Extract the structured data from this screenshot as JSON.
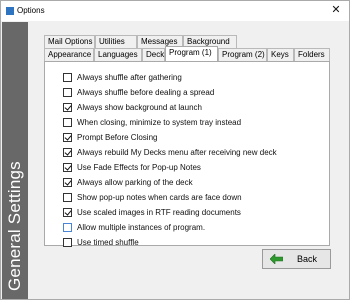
{
  "window": {
    "title": "Options",
    "close_glyph": "✕"
  },
  "side_banner": {
    "text": "General Settings"
  },
  "tabs_row1": [
    {
      "label": "Mail Options"
    },
    {
      "label": "Utilities"
    },
    {
      "label": "Messages"
    },
    {
      "label": "Background"
    }
  ],
  "tabs_row2": [
    {
      "label": "Appearance"
    },
    {
      "label": "Languages"
    },
    {
      "label": "Deck"
    },
    {
      "label": "Program (1)",
      "active": true
    },
    {
      "label": "Program (2)"
    },
    {
      "label": "Keys"
    },
    {
      "label": "Folders"
    }
  ],
  "options": [
    {
      "label": "Always shuffle after gathering",
      "checked": false
    },
    {
      "label": "Always shuffle before dealing a spread",
      "checked": false
    },
    {
      "label": "Always show background at launch",
      "checked": true
    },
    {
      "label": "When closing, minimize to system tray instead",
      "checked": false
    },
    {
      "label": "Prompt Before Closing",
      "checked": true
    },
    {
      "label": "Always rebuild My Decks menu after receiving new deck",
      "checked": true
    },
    {
      "label": "Use Fade Effects for Pop-up Notes",
      "checked": true
    },
    {
      "label": "Always allow parking of the deck",
      "checked": true
    },
    {
      "label": "Show pop-up notes when cards are face down",
      "checked": false
    },
    {
      "label": "Use scaled images in RTF reading documents",
      "checked": true
    },
    {
      "label": "Allow multiple instances of program.",
      "checked": false,
      "focused": true
    },
    {
      "label": "Use timed shuffle",
      "checked": false
    }
  ],
  "back_button": {
    "label": "Back",
    "icon": "green-left-arrow-icon"
  },
  "colors": {
    "banner": "#686868",
    "arrow": "#2e9a2e",
    "focus_border": "#4a84d4"
  }
}
